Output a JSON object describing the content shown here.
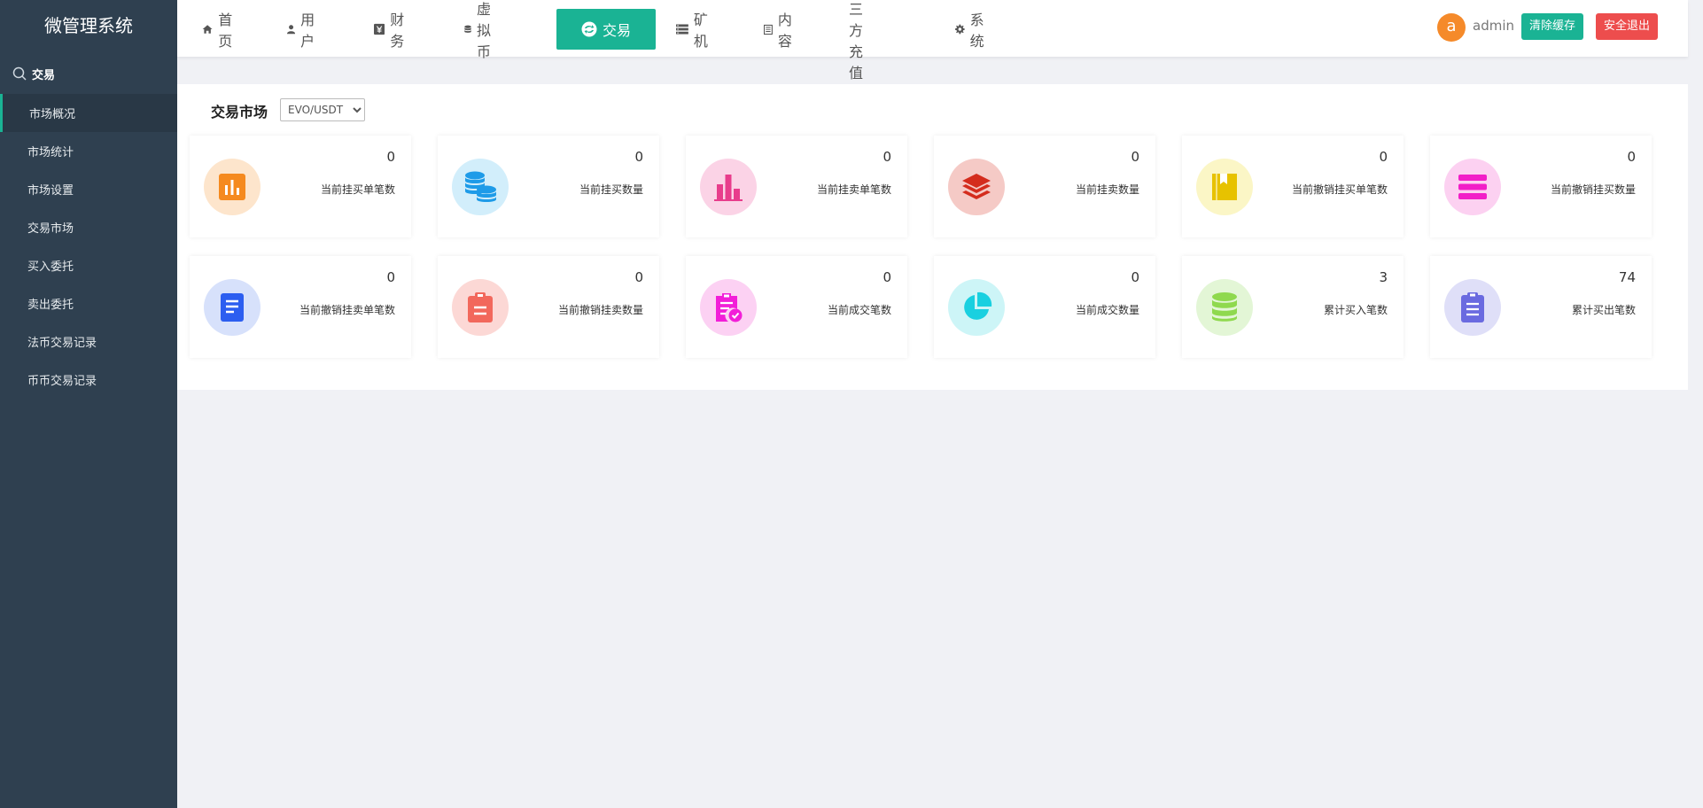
{
  "app": {
    "title": "微管理系统"
  },
  "sidebar": {
    "section": "交易",
    "items": [
      {
        "label": "市场概况",
        "active": true
      },
      {
        "label": "市场统计"
      },
      {
        "label": "市场设置"
      },
      {
        "label": "交易市场"
      },
      {
        "label": "买入委托"
      },
      {
        "label": "卖出委托"
      },
      {
        "label": "法币交易记录"
      },
      {
        "label": "币币交易记录"
      }
    ]
  },
  "nav": {
    "items": [
      {
        "label": "首页",
        "icon": "home-icon"
      },
      {
        "label": "用户",
        "icon": "user-icon"
      },
      {
        "label": "财务",
        "icon": "finance-icon"
      },
      {
        "label": "虚拟币",
        "icon": "database-icon"
      },
      {
        "label": "交易",
        "icon": "exchange-icon",
        "active": true
      },
      {
        "label": "矿机",
        "icon": "server-icon"
      },
      {
        "label": "内容",
        "icon": "document-icon"
      },
      {
        "label": "第三方充值"
      },
      {
        "label": "系统",
        "icon": "gear-icon"
      }
    ]
  },
  "user": {
    "avatar_letter": "a",
    "name": "admin"
  },
  "buttons": {
    "clear_cache": "清除缓存",
    "logout": "安全退出"
  },
  "market": {
    "label": "交易市场",
    "selected": "EVO/USDT"
  },
  "stats": [
    {
      "value": "0",
      "label": "当前挂买单笔数",
      "icon": "bar-chart-icon",
      "color": "#f58a1f",
      "bg": "#fde5cc"
    },
    {
      "value": "0",
      "label": "当前挂买数量",
      "icon": "coins-icon",
      "color": "#1e9be8",
      "bg": "#d2eefb"
    },
    {
      "value": "0",
      "label": "当前挂卖单笔数",
      "icon": "column-chart-icon",
      "color": "#e83d8c",
      "bg": "#fbd3e6"
    },
    {
      "value": "0",
      "label": "当前挂卖数量",
      "icon": "layers-icon",
      "color": "#d42c1d",
      "bg": "#f5cac6"
    },
    {
      "value": "0",
      "label": "当前撤销挂买单笔数",
      "icon": "book-icon",
      "color": "#e7c200",
      "bg": "#fbf6c6"
    },
    {
      "value": "0",
      "label": "当前撤销挂买数量",
      "icon": "list-icon",
      "color": "#f21ec8",
      "bg": "#fcd1f1"
    },
    {
      "value": "0",
      "label": "当前撤销挂卖单笔数",
      "icon": "file-icon",
      "color": "#2c5ef0",
      "bg": "#d7e1fb"
    },
    {
      "value": "0",
      "label": "当前撤销挂卖数量",
      "icon": "clipboard-icon",
      "color": "#f2685c",
      "bg": "#fcd8d5"
    },
    {
      "value": "0",
      "label": "当前成交笔数",
      "icon": "clipboard-check-icon",
      "color": "#f21ed8",
      "bg": "#fcd1f3"
    },
    {
      "value": "0",
      "label": "当前成交数量",
      "icon": "pie-chart-icon",
      "color": "#19d0e0",
      "bg": "#cdf5f7"
    },
    {
      "value": "3",
      "label": "累计买入笔数",
      "icon": "database-stack-icon",
      "color": "#8fd94e",
      "bg": "#e3f6d6"
    },
    {
      "value": "74",
      "label": "累计买出笔数",
      "icon": "notepad-icon",
      "color": "#6a6ae0",
      "bg": "#dfdff8"
    }
  ]
}
